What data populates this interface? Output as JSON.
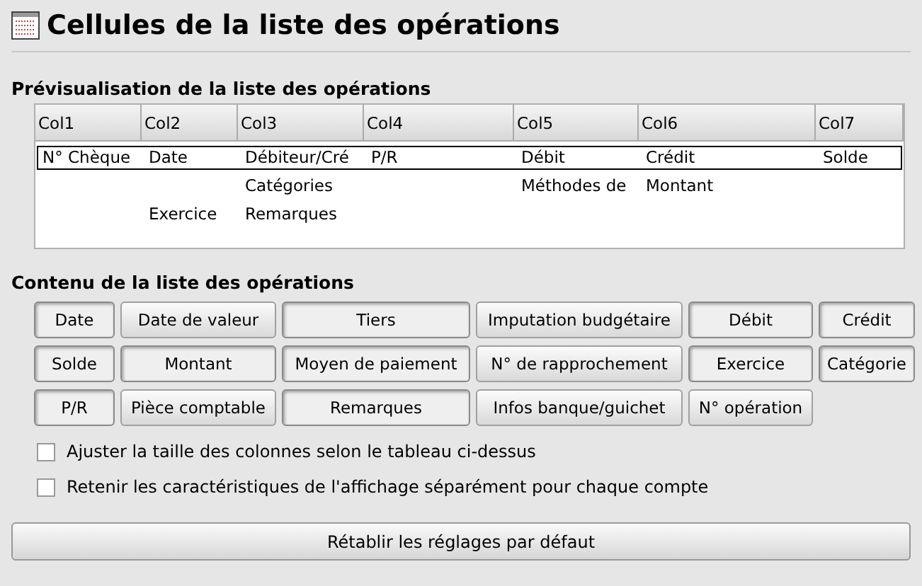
{
  "window": {
    "title": "Cellules de la liste des opérations"
  },
  "preview": {
    "heading": "Prévisualisation de la liste des opérations",
    "columns": [
      "Col1",
      "Col2",
      "Col3",
      "Col4",
      "Col5",
      "Col6",
      "Col7"
    ],
    "rows": [
      {
        "selected": true,
        "cells": [
          "N° Chèque",
          "Date",
          "Débiteur/Cré",
          "P/R",
          "Débit",
          "Crédit",
          "Solde"
        ]
      },
      {
        "selected": false,
        "cells": [
          null,
          null,
          "Catégories",
          null,
          "Méthodes de",
          "Montant",
          null
        ]
      },
      {
        "selected": false,
        "cells": [
          null,
          "Exercice",
          "Remarques",
          null,
          null,
          null,
          null
        ]
      }
    ]
  },
  "content": {
    "heading": "Contenu de la liste des opérations",
    "buttons": [
      {
        "label": "Date",
        "active": true
      },
      {
        "label": "Date de valeur",
        "active": false
      },
      {
        "label": "Tiers",
        "active": true
      },
      {
        "label": "Imputation budgétaire",
        "active": false
      },
      {
        "label": "Débit",
        "active": true
      },
      {
        "label": "Crédit",
        "active": true
      },
      {
        "label": "Solde",
        "active": true
      },
      {
        "label": "Montant",
        "active": true
      },
      {
        "label": "Moyen de paiement",
        "active": true
      },
      {
        "label": "N° de rapprochement",
        "active": false
      },
      {
        "label": "Exercice",
        "active": true
      },
      {
        "label": "Catégorie",
        "active": true
      },
      {
        "label": "P/R",
        "active": true
      },
      {
        "label": "Pièce comptable",
        "active": false
      },
      {
        "label": "Remarques",
        "active": true
      },
      {
        "label": "Infos banque/guichet",
        "active": false
      },
      {
        "label": "N° opération",
        "active": false
      }
    ]
  },
  "options": [
    {
      "label": "Ajuster la taille des colonnes selon le tableau ci-dessus",
      "checked": false
    },
    {
      "label": "Retenir les caractéristiques de l'affichage séparément pour chaque compte",
      "checked": false
    }
  ],
  "reset_button": "Rétablir les réglages par défaut"
}
